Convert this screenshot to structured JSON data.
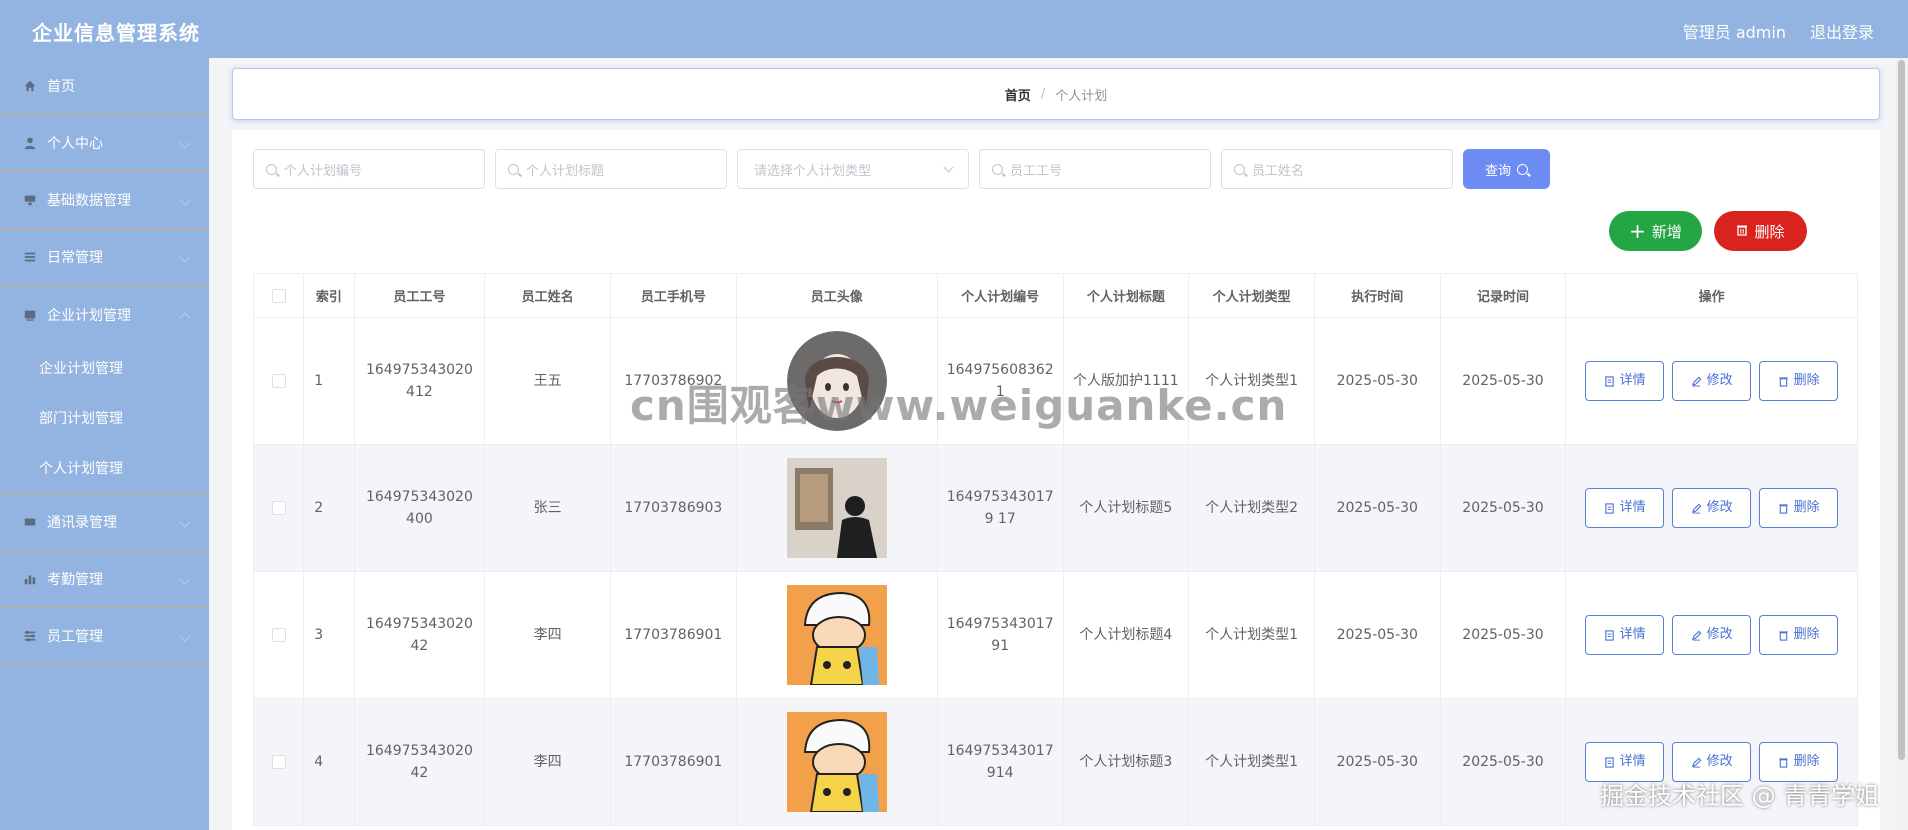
{
  "app": {
    "title": "企业信息管理系统",
    "user_label": "管理员 admin",
    "logout": "退出登录"
  },
  "sidebar": {
    "items": [
      {
        "label": "首页",
        "icon": "home-icon"
      },
      {
        "label": "个人中心",
        "icon": "user-icon"
      },
      {
        "label": "基础数据管理",
        "icon": "data-icon"
      },
      {
        "label": "日常管理",
        "icon": "list-icon"
      },
      {
        "label": "企业计划管理",
        "icon": "plan-icon"
      },
      {
        "label": "通讯录管理",
        "icon": "contacts-icon"
      },
      {
        "label": "考勤管理",
        "icon": "chart-icon"
      },
      {
        "label": "员工管理",
        "icon": "settings-icon"
      }
    ],
    "sub_items": [
      "企业计划管理",
      "部门计划管理",
      "个人计划管理"
    ]
  },
  "breadcrumb": {
    "home": "首页",
    "sep": "/",
    "current": "个人计划"
  },
  "search": {
    "plan_no_placeholder": "个人计划编号",
    "plan_title_placeholder": "个人计划标题",
    "plan_type_placeholder": "请选择个人计划类型",
    "emp_no_placeholder": "员工工号",
    "emp_name_placeholder": "员工姓名",
    "query_label": "查询"
  },
  "toolbar": {
    "add_label": "新增",
    "delete_label": "删除"
  },
  "table": {
    "headers": [
      "",
      "索引",
      "员工工号",
      "员工姓名",
      "员工手机号",
      "员工头像",
      "个人计划编号",
      "个人计划标题",
      "个人计划类型",
      "执行时间",
      "记录时间",
      "操作"
    ],
    "rows": [
      {
        "index": "1",
        "emp_no": "164975343020412",
        "name": "王五",
        "phone": "17703786902",
        "plan_no": "1649756083621",
        "title": "个人版加护1111",
        "type": "个人计划类型1",
        "exec": "2025-05-30",
        "record": "2025-05-30"
      },
      {
        "index": "2",
        "emp_no": "164975343020400",
        "name": "张三",
        "phone": "17703786903",
        "plan_no": "1649753430179 17",
        "title": "个人计划标题5",
        "type": "个人计划类型2",
        "exec": "2025-05-30",
        "record": "2025-05-30"
      },
      {
        "index": "3",
        "emp_no": "16497534302042",
        "name": "李四",
        "phone": "17703786901",
        "plan_no": "164975343017 91",
        "title": "个人计划标题4",
        "type": "个人计划类型1",
        "exec": "2025-05-30",
        "record": "2025-05-30"
      },
      {
        "index": "4",
        "emp_no": "16497534302042",
        "name": "李四",
        "phone": "17703786901",
        "plan_no": "164975343017 914",
        "title": "个人计划标题3",
        "type": "个人计划类型1",
        "exec": "2025-05-30",
        "record": "2025-05-30"
      }
    ],
    "ops": {
      "detail": "详情",
      "edit": "修改",
      "delete": "删除"
    }
  },
  "watermark": "cn围观客www.weiguanke.cn",
  "corner_note": "掘金技术社区 @ 青青学姐",
  "colors": {
    "topbar": "#93b4e0",
    "query": "#6c8cf4",
    "add": "#24a644",
    "delete": "#d9231f"
  }
}
